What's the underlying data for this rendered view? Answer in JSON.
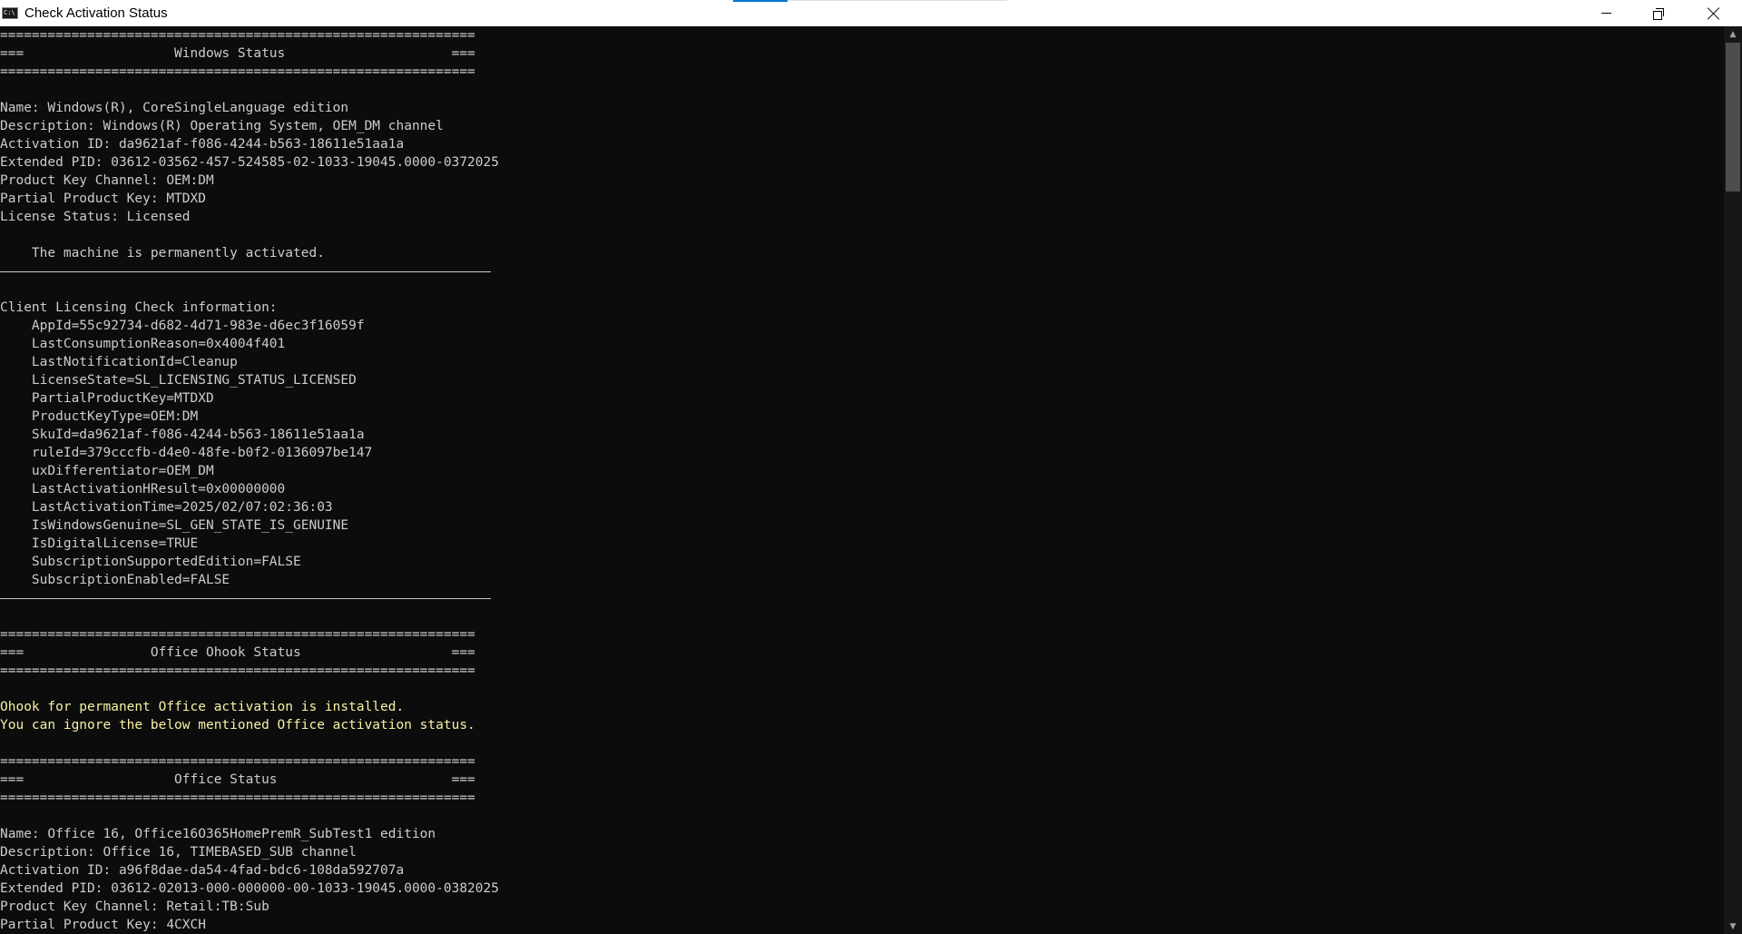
{
  "window": {
    "title": "Check Activation Status",
    "icon_text": "C:\\"
  },
  "console": {
    "lines": [
      {
        "kind": "text",
        "text": "============================================================"
      },
      {
        "kind": "text",
        "text": "===                   Windows Status                     ==="
      },
      {
        "kind": "text",
        "text": "============================================================"
      },
      {
        "kind": "text",
        "text": ""
      },
      {
        "kind": "text",
        "text": "Name: Windows(R), CoreSingleLanguage edition"
      },
      {
        "kind": "text",
        "text": "Description: Windows(R) Operating System, OEM_DM channel"
      },
      {
        "kind": "text",
        "text": "Activation ID: da9621af-f086-4244-b563-18611e51aa1a"
      },
      {
        "kind": "text",
        "text": "Extended PID: 03612-03562-457-524585-02-1033-19045.0000-0372025"
      },
      {
        "kind": "text",
        "text": "Product Key Channel: OEM:DM"
      },
      {
        "kind": "text",
        "text": "Partial Product Key: MTDXD"
      },
      {
        "kind": "text",
        "text": "License Status: Licensed"
      },
      {
        "kind": "text",
        "text": ""
      },
      {
        "kind": "text",
        "text": "    The machine is permanently activated."
      },
      {
        "kind": "rule",
        "text": ""
      },
      {
        "kind": "text",
        "text": ""
      },
      {
        "kind": "text",
        "text": "Client Licensing Check information:"
      },
      {
        "kind": "text",
        "text": "    AppId=55c92734-d682-4d71-983e-d6ec3f16059f"
      },
      {
        "kind": "text",
        "text": "    LastConsumptionReason=0x4004f401"
      },
      {
        "kind": "text",
        "text": "    LastNotificationId=Cleanup"
      },
      {
        "kind": "text",
        "text": "    LicenseState=SL_LICENSING_STATUS_LICENSED"
      },
      {
        "kind": "text",
        "text": "    PartialProductKey=MTDXD"
      },
      {
        "kind": "text",
        "text": "    ProductKeyType=OEM:DM"
      },
      {
        "kind": "text",
        "text": "    SkuId=da9621af-f086-4244-b563-18611e51aa1a"
      },
      {
        "kind": "text",
        "text": "    ruleId=379cccfb-d4e0-48fe-b0f2-0136097be147"
      },
      {
        "kind": "text",
        "text": "    uxDifferentiator=OEM_DM"
      },
      {
        "kind": "text",
        "text": "    LastActivationHResult=0x00000000"
      },
      {
        "kind": "text",
        "text": "    LastActivationTime=2025/02/07:02:36:03"
      },
      {
        "kind": "text",
        "text": "    IsWindowsGenuine=SL_GEN_STATE_IS_GENUINE"
      },
      {
        "kind": "text",
        "text": "    IsDigitalLicense=TRUE"
      },
      {
        "kind": "text",
        "text": "    SubscriptionSupportedEdition=FALSE"
      },
      {
        "kind": "text",
        "text": "    SubscriptionEnabled=FALSE"
      },
      {
        "kind": "rule",
        "text": ""
      },
      {
        "kind": "text",
        "text": ""
      },
      {
        "kind": "text",
        "text": "============================================================"
      },
      {
        "kind": "text",
        "text": "===                Office Ohook Status                   ==="
      },
      {
        "kind": "text",
        "text": "============================================================"
      },
      {
        "kind": "text",
        "text": ""
      },
      {
        "kind": "yellow",
        "text": "Ohook for permanent Office activation is installed."
      },
      {
        "kind": "yellow",
        "text": "You can ignore the below mentioned Office activation status."
      },
      {
        "kind": "text",
        "text": ""
      },
      {
        "kind": "text",
        "text": "============================================================"
      },
      {
        "kind": "text",
        "text": "===                   Office Status                      ==="
      },
      {
        "kind": "text",
        "text": "============================================================"
      },
      {
        "kind": "text",
        "text": ""
      },
      {
        "kind": "text",
        "text": "Name: Office 16, Office16O365HomePremR_SubTest1 edition"
      },
      {
        "kind": "text",
        "text": "Description: Office 16, TIMEBASED_SUB channel"
      },
      {
        "kind": "text",
        "text": "Activation ID: a96f8dae-da54-4fad-bdc6-108da592707a"
      },
      {
        "kind": "text",
        "text": "Extended PID: 03612-02013-000-000000-00-1033-19045.0000-0382025"
      },
      {
        "kind": "text",
        "text": "Product Key Channel: Retail:TB:Sub"
      },
      {
        "kind": "text",
        "text": "Partial Product Key: 4CXCH"
      }
    ]
  },
  "colors": {
    "background": "#0c0c0c",
    "text": "#cccccc",
    "highlight": "#f9f1a5"
  }
}
